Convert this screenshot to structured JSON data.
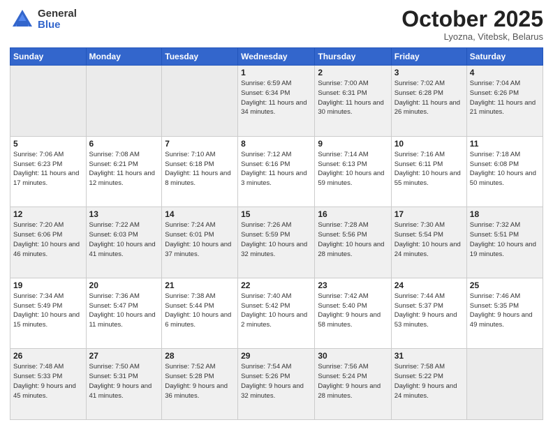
{
  "header": {
    "logo_general": "General",
    "logo_blue": "Blue",
    "month_title": "October 2025",
    "location": "Lyozna, Vitebsk, Belarus"
  },
  "weekdays": [
    "Sunday",
    "Monday",
    "Tuesday",
    "Wednesday",
    "Thursday",
    "Friday",
    "Saturday"
  ],
  "weeks": [
    [
      {
        "day": "",
        "info": ""
      },
      {
        "day": "",
        "info": ""
      },
      {
        "day": "",
        "info": ""
      },
      {
        "day": "1",
        "info": "Sunrise: 6:59 AM\nSunset: 6:34 PM\nDaylight: 11 hours\nand 34 minutes."
      },
      {
        "day": "2",
        "info": "Sunrise: 7:00 AM\nSunset: 6:31 PM\nDaylight: 11 hours\nand 30 minutes."
      },
      {
        "day": "3",
        "info": "Sunrise: 7:02 AM\nSunset: 6:28 PM\nDaylight: 11 hours\nand 26 minutes."
      },
      {
        "day": "4",
        "info": "Sunrise: 7:04 AM\nSunset: 6:26 PM\nDaylight: 11 hours\nand 21 minutes."
      }
    ],
    [
      {
        "day": "5",
        "info": "Sunrise: 7:06 AM\nSunset: 6:23 PM\nDaylight: 11 hours\nand 17 minutes."
      },
      {
        "day": "6",
        "info": "Sunrise: 7:08 AM\nSunset: 6:21 PM\nDaylight: 11 hours\nand 12 minutes."
      },
      {
        "day": "7",
        "info": "Sunrise: 7:10 AM\nSunset: 6:18 PM\nDaylight: 11 hours\nand 8 minutes."
      },
      {
        "day": "8",
        "info": "Sunrise: 7:12 AM\nSunset: 6:16 PM\nDaylight: 11 hours\nand 3 minutes."
      },
      {
        "day": "9",
        "info": "Sunrise: 7:14 AM\nSunset: 6:13 PM\nDaylight: 10 hours\nand 59 minutes."
      },
      {
        "day": "10",
        "info": "Sunrise: 7:16 AM\nSunset: 6:11 PM\nDaylight: 10 hours\nand 55 minutes."
      },
      {
        "day": "11",
        "info": "Sunrise: 7:18 AM\nSunset: 6:08 PM\nDaylight: 10 hours\nand 50 minutes."
      }
    ],
    [
      {
        "day": "12",
        "info": "Sunrise: 7:20 AM\nSunset: 6:06 PM\nDaylight: 10 hours\nand 46 minutes."
      },
      {
        "day": "13",
        "info": "Sunrise: 7:22 AM\nSunset: 6:03 PM\nDaylight: 10 hours\nand 41 minutes."
      },
      {
        "day": "14",
        "info": "Sunrise: 7:24 AM\nSunset: 6:01 PM\nDaylight: 10 hours\nand 37 minutes."
      },
      {
        "day": "15",
        "info": "Sunrise: 7:26 AM\nSunset: 5:59 PM\nDaylight: 10 hours\nand 32 minutes."
      },
      {
        "day": "16",
        "info": "Sunrise: 7:28 AM\nSunset: 5:56 PM\nDaylight: 10 hours\nand 28 minutes."
      },
      {
        "day": "17",
        "info": "Sunrise: 7:30 AM\nSunset: 5:54 PM\nDaylight: 10 hours\nand 24 minutes."
      },
      {
        "day": "18",
        "info": "Sunrise: 7:32 AM\nSunset: 5:51 PM\nDaylight: 10 hours\nand 19 minutes."
      }
    ],
    [
      {
        "day": "19",
        "info": "Sunrise: 7:34 AM\nSunset: 5:49 PM\nDaylight: 10 hours\nand 15 minutes."
      },
      {
        "day": "20",
        "info": "Sunrise: 7:36 AM\nSunset: 5:47 PM\nDaylight: 10 hours\nand 11 minutes."
      },
      {
        "day": "21",
        "info": "Sunrise: 7:38 AM\nSunset: 5:44 PM\nDaylight: 10 hours\nand 6 minutes."
      },
      {
        "day": "22",
        "info": "Sunrise: 7:40 AM\nSunset: 5:42 PM\nDaylight: 10 hours\nand 2 minutes."
      },
      {
        "day": "23",
        "info": "Sunrise: 7:42 AM\nSunset: 5:40 PM\nDaylight: 9 hours\nand 58 minutes."
      },
      {
        "day": "24",
        "info": "Sunrise: 7:44 AM\nSunset: 5:37 PM\nDaylight: 9 hours\nand 53 minutes."
      },
      {
        "day": "25",
        "info": "Sunrise: 7:46 AM\nSunset: 5:35 PM\nDaylight: 9 hours\nand 49 minutes."
      }
    ],
    [
      {
        "day": "26",
        "info": "Sunrise: 7:48 AM\nSunset: 5:33 PM\nDaylight: 9 hours\nand 45 minutes."
      },
      {
        "day": "27",
        "info": "Sunrise: 7:50 AM\nSunset: 5:31 PM\nDaylight: 9 hours\nand 41 minutes."
      },
      {
        "day": "28",
        "info": "Sunrise: 7:52 AM\nSunset: 5:28 PM\nDaylight: 9 hours\nand 36 minutes."
      },
      {
        "day": "29",
        "info": "Sunrise: 7:54 AM\nSunset: 5:26 PM\nDaylight: 9 hours\nand 32 minutes."
      },
      {
        "day": "30",
        "info": "Sunrise: 7:56 AM\nSunset: 5:24 PM\nDaylight: 9 hours\nand 28 minutes."
      },
      {
        "day": "31",
        "info": "Sunrise: 7:58 AM\nSunset: 5:22 PM\nDaylight: 9 hours\nand 24 minutes."
      },
      {
        "day": "",
        "info": ""
      }
    ]
  ]
}
